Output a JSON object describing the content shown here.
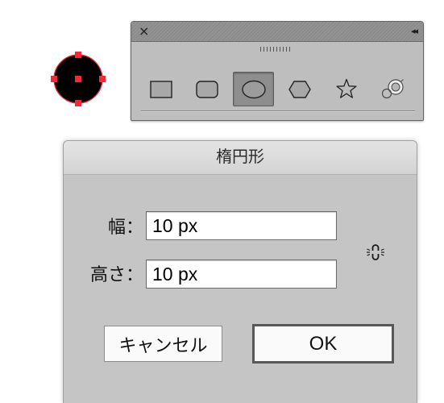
{
  "canvas": {
    "selected_object": {
      "fill": "#000000",
      "selection_color": "#ee2b36"
    }
  },
  "tools_panel": {
    "close_icon": "close-icon",
    "close_glyph": "×",
    "collapse_icon": "collapse-panel-icon",
    "collapse_glyph": "◂◂",
    "grip_icon": "grip-icon",
    "tools": [
      {
        "icon": "rectangle-icon",
        "selected": false
      },
      {
        "icon": "rounded-rectangle-icon",
        "selected": false
      },
      {
        "icon": "ellipse-icon",
        "selected": true
      },
      {
        "icon": "hexagon-icon",
        "selected": false
      },
      {
        "icon": "star-icon",
        "selected": false
      },
      {
        "icon": "flare-icon",
        "selected": false
      }
    ]
  },
  "dialog": {
    "title": "楕円形",
    "width_label": "幅：",
    "width_value": "10 px",
    "height_label": "高さ：",
    "height_value": "10 px",
    "constrain_icon": "broken-link-icon",
    "cancel_label": "キャンセル",
    "ok_label": "OK",
    "ok_is_default": true
  }
}
